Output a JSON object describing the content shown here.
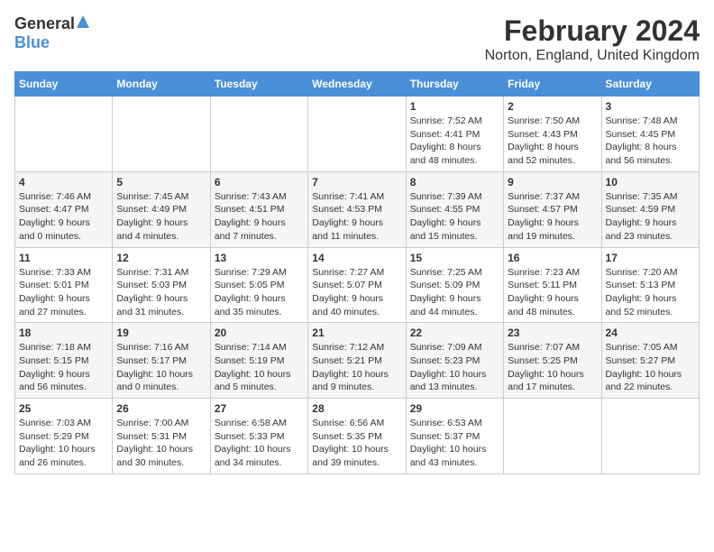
{
  "header": {
    "logo_general": "General",
    "logo_blue": "Blue",
    "month_year": "February 2024",
    "location": "Norton, England, United Kingdom"
  },
  "weekdays": [
    "Sunday",
    "Monday",
    "Tuesday",
    "Wednesday",
    "Thursday",
    "Friday",
    "Saturday"
  ],
  "weeks": [
    [
      {
        "day": "",
        "info": ""
      },
      {
        "day": "",
        "info": ""
      },
      {
        "day": "",
        "info": ""
      },
      {
        "day": "",
        "info": ""
      },
      {
        "day": "1",
        "info": "Sunrise: 7:52 AM\nSunset: 4:41 PM\nDaylight: 8 hours\nand 48 minutes."
      },
      {
        "day": "2",
        "info": "Sunrise: 7:50 AM\nSunset: 4:43 PM\nDaylight: 8 hours\nand 52 minutes."
      },
      {
        "day": "3",
        "info": "Sunrise: 7:48 AM\nSunset: 4:45 PM\nDaylight: 8 hours\nand 56 minutes."
      }
    ],
    [
      {
        "day": "4",
        "info": "Sunrise: 7:46 AM\nSunset: 4:47 PM\nDaylight: 9 hours\nand 0 minutes."
      },
      {
        "day": "5",
        "info": "Sunrise: 7:45 AM\nSunset: 4:49 PM\nDaylight: 9 hours\nand 4 minutes."
      },
      {
        "day": "6",
        "info": "Sunrise: 7:43 AM\nSunset: 4:51 PM\nDaylight: 9 hours\nand 7 minutes."
      },
      {
        "day": "7",
        "info": "Sunrise: 7:41 AM\nSunset: 4:53 PM\nDaylight: 9 hours\nand 11 minutes."
      },
      {
        "day": "8",
        "info": "Sunrise: 7:39 AM\nSunset: 4:55 PM\nDaylight: 9 hours\nand 15 minutes."
      },
      {
        "day": "9",
        "info": "Sunrise: 7:37 AM\nSunset: 4:57 PM\nDaylight: 9 hours\nand 19 minutes."
      },
      {
        "day": "10",
        "info": "Sunrise: 7:35 AM\nSunset: 4:59 PM\nDaylight: 9 hours\nand 23 minutes."
      }
    ],
    [
      {
        "day": "11",
        "info": "Sunrise: 7:33 AM\nSunset: 5:01 PM\nDaylight: 9 hours\nand 27 minutes."
      },
      {
        "day": "12",
        "info": "Sunrise: 7:31 AM\nSunset: 5:03 PM\nDaylight: 9 hours\nand 31 minutes."
      },
      {
        "day": "13",
        "info": "Sunrise: 7:29 AM\nSunset: 5:05 PM\nDaylight: 9 hours\nand 35 minutes."
      },
      {
        "day": "14",
        "info": "Sunrise: 7:27 AM\nSunset: 5:07 PM\nDaylight: 9 hours\nand 40 minutes."
      },
      {
        "day": "15",
        "info": "Sunrise: 7:25 AM\nSunset: 5:09 PM\nDaylight: 9 hours\nand 44 minutes."
      },
      {
        "day": "16",
        "info": "Sunrise: 7:23 AM\nSunset: 5:11 PM\nDaylight: 9 hours\nand 48 minutes."
      },
      {
        "day": "17",
        "info": "Sunrise: 7:20 AM\nSunset: 5:13 PM\nDaylight: 9 hours\nand 52 minutes."
      }
    ],
    [
      {
        "day": "18",
        "info": "Sunrise: 7:18 AM\nSunset: 5:15 PM\nDaylight: 9 hours\nand 56 minutes."
      },
      {
        "day": "19",
        "info": "Sunrise: 7:16 AM\nSunset: 5:17 PM\nDaylight: 10 hours\nand 0 minutes."
      },
      {
        "day": "20",
        "info": "Sunrise: 7:14 AM\nSunset: 5:19 PM\nDaylight: 10 hours\nand 5 minutes."
      },
      {
        "day": "21",
        "info": "Sunrise: 7:12 AM\nSunset: 5:21 PM\nDaylight: 10 hours\nand 9 minutes."
      },
      {
        "day": "22",
        "info": "Sunrise: 7:09 AM\nSunset: 5:23 PM\nDaylight: 10 hours\nand 13 minutes."
      },
      {
        "day": "23",
        "info": "Sunrise: 7:07 AM\nSunset: 5:25 PM\nDaylight: 10 hours\nand 17 minutes."
      },
      {
        "day": "24",
        "info": "Sunrise: 7:05 AM\nSunset: 5:27 PM\nDaylight: 10 hours\nand 22 minutes."
      }
    ],
    [
      {
        "day": "25",
        "info": "Sunrise: 7:03 AM\nSunset: 5:29 PM\nDaylight: 10 hours\nand 26 minutes."
      },
      {
        "day": "26",
        "info": "Sunrise: 7:00 AM\nSunset: 5:31 PM\nDaylight: 10 hours\nand 30 minutes."
      },
      {
        "day": "27",
        "info": "Sunrise: 6:58 AM\nSunset: 5:33 PM\nDaylight: 10 hours\nand 34 minutes."
      },
      {
        "day": "28",
        "info": "Sunrise: 6:56 AM\nSunset: 5:35 PM\nDaylight: 10 hours\nand 39 minutes."
      },
      {
        "day": "29",
        "info": "Sunrise: 6:53 AM\nSunset: 5:37 PM\nDaylight: 10 hours\nand 43 minutes."
      },
      {
        "day": "",
        "info": ""
      },
      {
        "day": "",
        "info": ""
      }
    ]
  ]
}
